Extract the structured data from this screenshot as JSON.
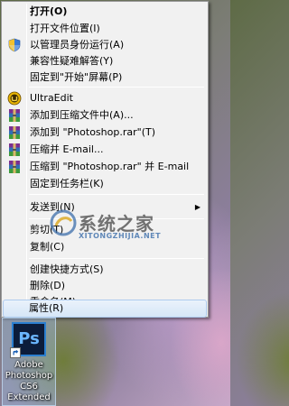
{
  "menu": {
    "items": [
      {
        "label": "打开(O)",
        "icon": "none"
      },
      {
        "label": "打开文件位置(I)",
        "icon": "none"
      },
      {
        "label": "以管理员身份运行(A)",
        "icon": "uac-shield-icon"
      },
      {
        "label": "兼容性疑难解答(Y)",
        "icon": "none"
      },
      {
        "label": "固定到\"开始\"屏幕(P)",
        "icon": "none"
      },
      {
        "label": "UltraEdit",
        "icon": "ultraedit-icon"
      },
      {
        "label": "添加到压缩文件中(A)...",
        "icon": "winrar-icon"
      },
      {
        "label": "添加到 \"Photoshop.rar\"(T)",
        "icon": "winrar-icon"
      },
      {
        "label": "压缩并 E-mail...",
        "icon": "winrar-icon"
      },
      {
        "label": "压缩到 \"Photoshop.rar\" 并 E-mail",
        "icon": "winrar-icon"
      },
      {
        "label": "固定到任务栏(K)",
        "icon": "none"
      },
      {
        "label": "发送到(N)",
        "icon": "none"
      },
      {
        "label": "剪切(T)",
        "icon": "none"
      },
      {
        "label": "复制(C)",
        "icon": "none"
      },
      {
        "label": "创建快捷方式(S)",
        "icon": "none"
      },
      {
        "label": "删除(D)",
        "icon": "none"
      },
      {
        "label": "重命名(M)",
        "icon": "none"
      },
      {
        "label": "属性(R)",
        "icon": "none"
      }
    ],
    "submenu_arrow": "▶"
  },
  "desktop_icon": {
    "badge": "Ps",
    "label_lines": [
      "Adobe",
      "Photoshop",
      "CS6",
      "Extended"
    ]
  },
  "watermark": {
    "text": "系统之家",
    "url": "XITONGZHIJIA.NET"
  },
  "colors": {
    "menu_bg": "#f1f1f1",
    "highlight_border": "#aecbee",
    "ps_blue": "#2b7fd0"
  }
}
